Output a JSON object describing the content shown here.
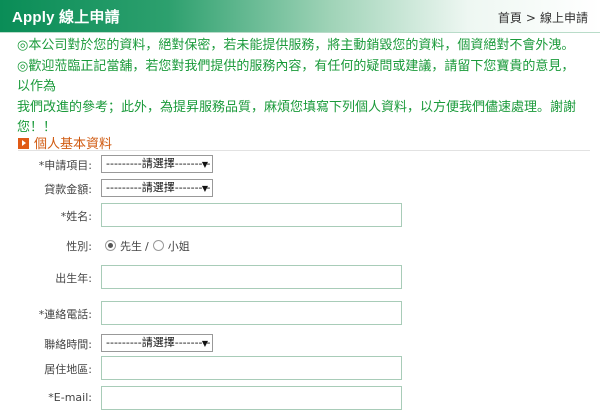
{
  "header": {
    "title": "Apply 線上申請",
    "breadcrumb": [
      "首頁",
      ">",
      "線上申請"
    ]
  },
  "notice": {
    "line1": "◎本公司對於您的資料，絕對保密，若未能提供服務，將主動銷毀您的資料，個資絕對不會外洩。",
    "line2": "◎歡迎蒞臨正記當舖，若您對我們提供的服務內容，有任何的疑問或建議，請留下您寶貴的意見，以作為",
    "line3": "我們改進的參考；此外，為提昇服務品質，麻煩您填寫下列個人資料，以方便我們儘速處理。謝謝您！！"
  },
  "section_title": "個人基本資料",
  "form": {
    "item_label": "*申請項目:",
    "item_value": "---------請選擇---------",
    "amount_label": "貸款金額:",
    "amount_value": "---------請選擇---------",
    "name_label": "*姓名:",
    "name_value": "",
    "gender_label": "性別:",
    "gender_options": [
      "先生",
      "小姐"
    ],
    "gender_selected": "先生",
    "gender_separator": "/",
    "birth_label": "出生年:",
    "birth_value": "",
    "phone_label": "*連絡電話:",
    "phone_value": "",
    "contact_time_label": "聯絡時間:",
    "contact_time_value": "---------請選擇---------",
    "address_label": "居住地區:",
    "address_value": "",
    "email_label": "*E-mail:",
    "email_value": ""
  },
  "colors": {
    "header_green": "#0a8d57",
    "notice_green": "#1a9a3a",
    "section_orange": "#d05a10",
    "input_border": "#a8ccb8"
  },
  "icons": {
    "section_marker": "orange-arrow-square-icon",
    "dropdown": "triangle-down-icon",
    "radio": "radio-icon"
  }
}
